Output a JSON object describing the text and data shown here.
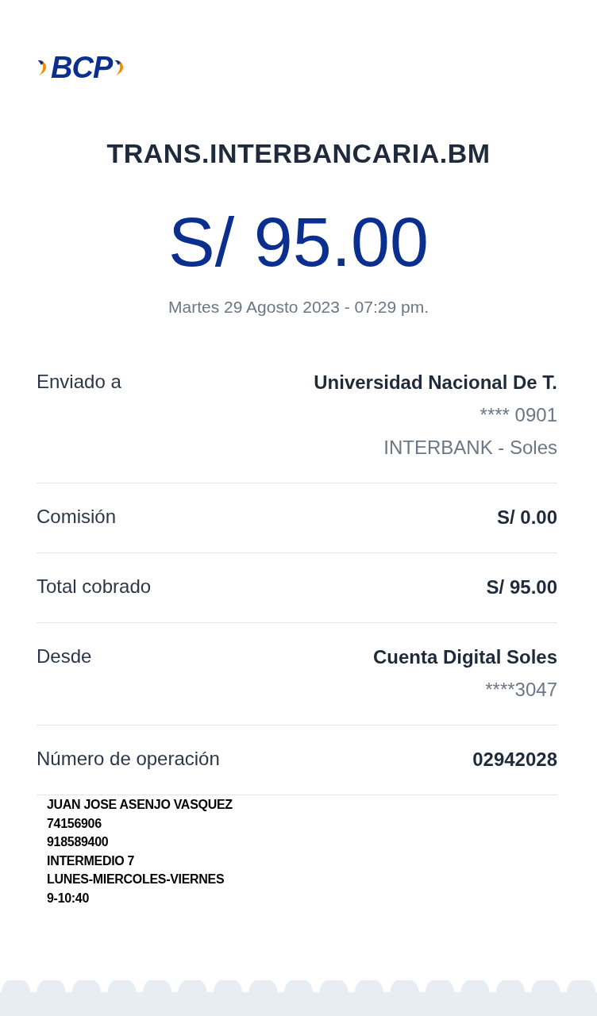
{
  "logo": "BCP",
  "title": "TRANS.INTERBANCARIA.BM",
  "amount": "S/ 95.00",
  "datetime": "Martes 29 Agosto 2023 - 07:29 pm.",
  "details": [
    {
      "label": "Enviado a",
      "values": [
        {
          "text": "Universidad Nacional De T.",
          "kind": "strong"
        },
        {
          "text": "**** 0901",
          "kind": "muted"
        },
        {
          "text": "INTERBANK - Soles",
          "kind": "muted"
        }
      ]
    },
    {
      "label": "Comisión",
      "values": [
        {
          "text": "S/ 0.00",
          "kind": "strong"
        }
      ]
    },
    {
      "label": "Total cobrado",
      "values": [
        {
          "text": "S/ 95.00",
          "kind": "strong"
        }
      ]
    },
    {
      "label": "Desde",
      "values": [
        {
          "text": "Cuenta Digital Soles",
          "kind": "strong"
        },
        {
          "text": "****3047",
          "kind": "muted"
        }
      ]
    },
    {
      "label": "Número de operación",
      "values": [
        {
          "text": "02942028",
          "kind": "strong"
        }
      ]
    }
  ],
  "note_lines": [
    "JUAN JOSE ASENJO VASQUEZ",
    "74156906",
    "918589400",
    "INTERMEDIO 7",
    "LUNES-MIERCOLES-VIERNES",
    "9-10:40"
  ]
}
